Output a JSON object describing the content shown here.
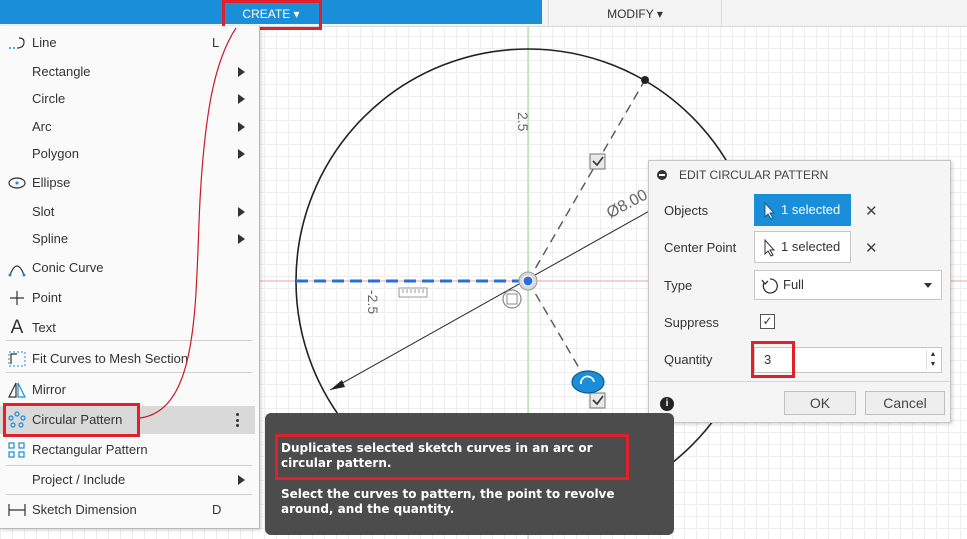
{
  "toolbar": {
    "create_label": "CREATE ▾",
    "modify_label": "MODIFY ▾"
  },
  "create_menu": {
    "items": [
      {
        "label": "Line",
        "shortcut": "L"
      },
      {
        "label": "Rectangle"
      },
      {
        "label": "Circle"
      },
      {
        "label": "Arc"
      },
      {
        "label": "Polygon"
      },
      {
        "label": "Ellipse"
      },
      {
        "label": "Slot"
      },
      {
        "label": "Spline"
      },
      {
        "label": "Conic Curve"
      },
      {
        "label": "Point"
      },
      {
        "label": "Text"
      },
      {
        "label": "Fit Curves to Mesh Section"
      },
      {
        "label": "Mirror"
      },
      {
        "label": "Circular Pattern"
      },
      {
        "label": "Rectangular Pattern"
      },
      {
        "label": "Project / Include"
      },
      {
        "label": "Sketch Dimension",
        "shortcut": "D"
      }
    ]
  },
  "sketch": {
    "dim_top": "2.5",
    "dim_left": "-2.5",
    "dim_diameter": "Ø8.00"
  },
  "dialog": {
    "title": "EDIT CIRCULAR PATTERN",
    "objects_label": "Objects",
    "objects_value": "1 selected",
    "center_label": "Center Point",
    "center_value": "1 selected",
    "type_label": "Type",
    "type_value": "Full",
    "suppress_label": "Suppress",
    "suppress_checked": true,
    "quantity_label": "Quantity",
    "quantity_value": "3",
    "ok_label": "OK",
    "cancel_label": "Cancel"
  },
  "tooltip": {
    "line1": "Duplicates selected sketch curves in an arc or circular pattern.",
    "line2": "Select the curves to pattern, the point to revolve around, and the quantity."
  },
  "colors": {
    "accent": "#1a8ed8",
    "highlight_box": "#e0202a",
    "tooltip_bg": "#4c4c4c"
  }
}
